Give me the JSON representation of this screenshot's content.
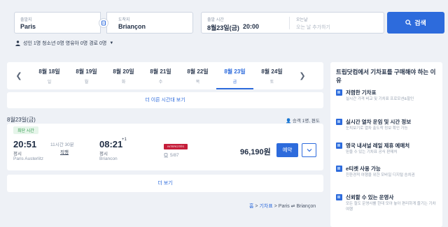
{
  "search": {
    "from_label": "출발지",
    "from_value": "Paris",
    "to_label": "도착지",
    "to_value": "Briançon",
    "depart_label": "출발 시간",
    "depart_date": "8월23일(금)",
    "depart_time": "20:00",
    "return_label": "오는날",
    "return_placeholder": "오는 날 추가하기",
    "search_button": "검색",
    "passengers": "성인 1명 청소년 0명 영유아 0명 경로 0명"
  },
  "date_strip": {
    "days": [
      {
        "date": "8월 18일",
        "weekday": "일"
      },
      {
        "date": "8월 19일",
        "weekday": "월"
      },
      {
        "date": "8월 20일",
        "weekday": "화"
      },
      {
        "date": "8월 21일",
        "weekday": "수"
      },
      {
        "date": "8월 22일",
        "weekday": "목"
      },
      {
        "date": "8월 23일",
        "weekday": "금",
        "selected": true
      },
      {
        "date": "8월 24일",
        "weekday": "토"
      }
    ]
  },
  "earlier_link": "더 이른 시간대 보기",
  "results": {
    "date": "8월23일(금)",
    "meta": "승객 1명, 편도",
    "items": [
      {
        "badge": "최단 시간",
        "dep_time": "20:51",
        "dep_kind": "정시",
        "dep_station": "Paris Austerlitz",
        "duration": "11시간 30분",
        "direct": "직행",
        "arr_time": "08:21",
        "arr_plus": "+1",
        "arr_kind": "정시",
        "arr_station": "Briancon",
        "operator_logo": "INTERCITÉS",
        "seats": "5/87",
        "price": "96,190원",
        "book_button": "예약"
      }
    ]
  },
  "more_button": "더 보기",
  "breadcrumb": {
    "home": "홈",
    "tickets": "기차표",
    "route": "Paris ⇌ Briançon",
    "sep": ">"
  },
  "panel": {
    "title": "트립닷컴에서 기차표를 구매해야 하는 이유",
    "features": [
      {
        "title": "저렴한 기차표",
        "desc": "실시간 가격 비교 및 기차표 프로모션&할인"
      },
      {
        "title": "실시간 열차 운임 및 시간 정보",
        "desc": "눈치보기로 열차 출도착 정보 확인 가능"
      },
      {
        "title": "영국 내셔널 레일 제휴 예매처",
        "desc": "믿을 수 있는 기차표 공식 판매처"
      },
      {
        "title": "e티켓 사용 가능",
        "desc": "친환경적 여행을 위한 모바일 디지털 승차권"
      },
      {
        "title": "신뢰할 수 있는 운영사",
        "desc": "모든 철도 운영사를 한데 모아 놓아 편리하게 즐기는 기차 여행"
      }
    ]
  },
  "colors": {
    "accent": "#2d6bdc",
    "background": "#eef1f6",
    "badge_green": "#2e9a4b",
    "operator_red": "#c51e3a"
  }
}
